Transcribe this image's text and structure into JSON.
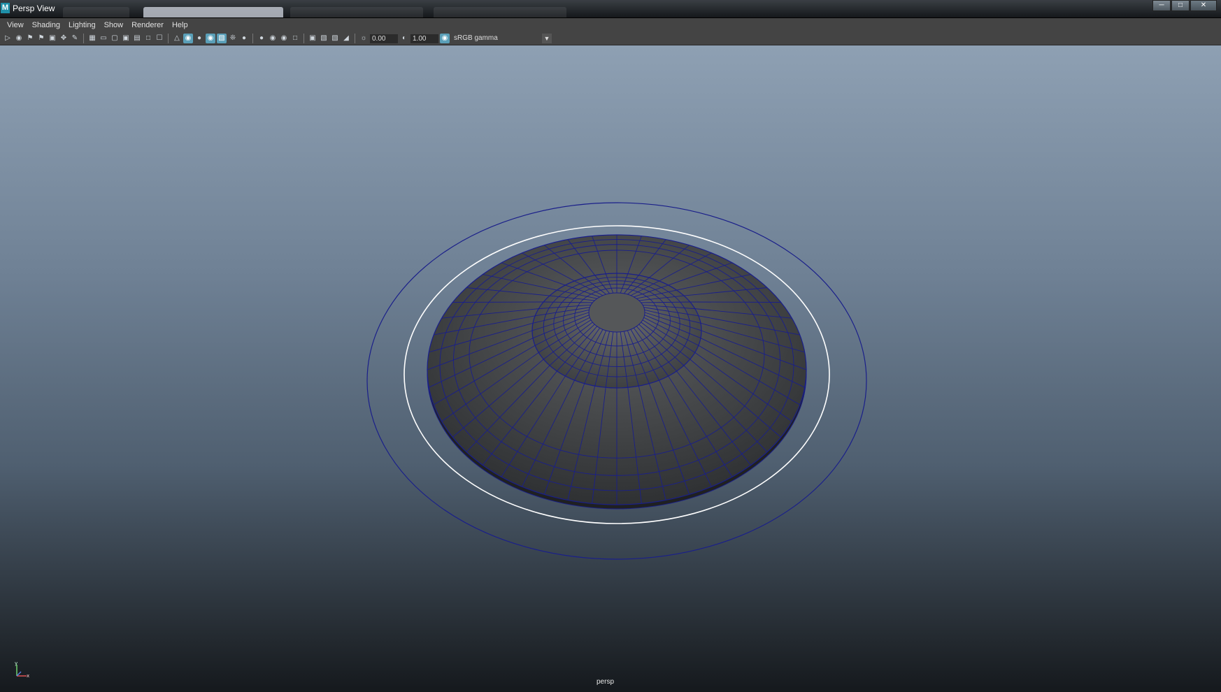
{
  "window": {
    "title": "Persp View",
    "app_icon_letter": "M",
    "controls": [
      "minimize",
      "maximize",
      "close"
    ]
  },
  "menu": {
    "items": [
      "View",
      "Shading",
      "Lighting",
      "Show",
      "Renderer",
      "Help"
    ]
  },
  "toolbar": {
    "exposure_value": "0.00",
    "gamma_value": "1.00",
    "color_space": "sRGB gamma",
    "icons": [
      "select-camera-icon",
      "camera-attributes-icon",
      "bookmark-icon",
      "bookmark-add-icon",
      "image-plane-icon",
      "2d-pan-zoom-icon",
      "grease-pencil-icon",
      "grid-icon",
      "film-gate-icon",
      "resolution-gate-icon",
      "gate-mask-icon",
      "field-chart-icon",
      "safe-action-icon",
      "safe-title-icon",
      "wireframe-icon",
      "smooth-shade-icon",
      "default-material-icon",
      "wireframe-on-shaded-icon",
      "xray-icon",
      "lights-icon",
      "shadows-icon",
      "ambient-occlusion-icon",
      "motion-blur-icon",
      "anti-alias-icon",
      "depth-of-field-icon",
      "isolate-select-icon",
      "xray-joints-icon",
      "xray-components-icon",
      "backface-icon",
      "exposure-icon",
      "gamma-icon",
      "color-management-icon"
    ],
    "active_icons": [
      "smooth-shade-icon",
      "wireframe-on-shaded-icon",
      "xray-icon",
      "color-management-icon"
    ]
  },
  "viewport": {
    "camera": "persp",
    "axis_labels": {
      "y": "y",
      "x": "x"
    }
  },
  "colors": {
    "wire": "#1a1f8a",
    "selection": "#ffffff",
    "mesh_dark": "#2d2f31",
    "mesh_light": "#5a5c5e"
  }
}
